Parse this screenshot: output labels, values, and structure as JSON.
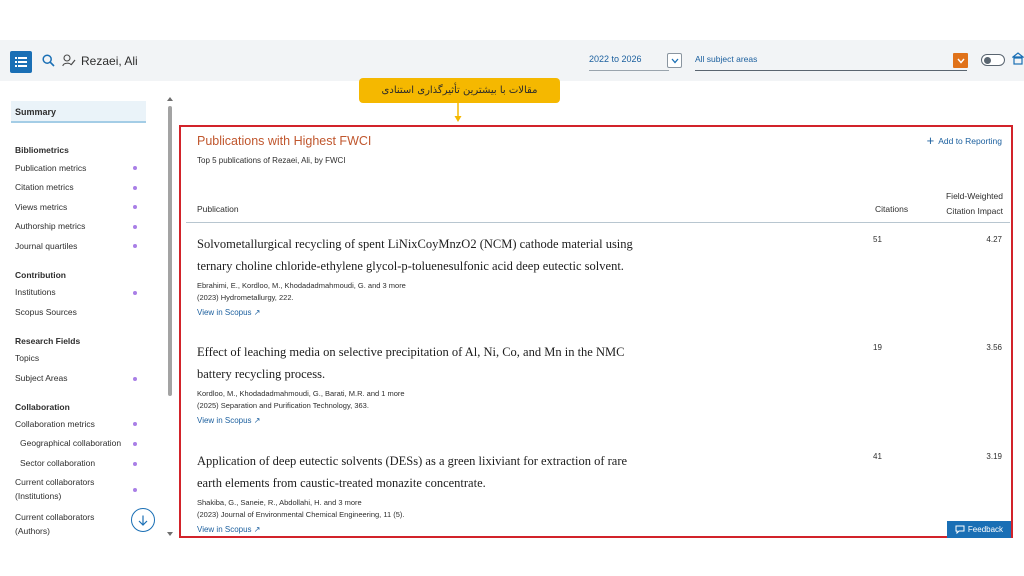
{
  "header": {
    "user_name": "Rezaei, Ali",
    "date_range": "2022 to 2026",
    "subject_area": "All subject areas"
  },
  "sidebar": {
    "summary": "Summary",
    "sections": [
      {
        "title": "Bibliometrics",
        "items": [
          "Publication metrics",
          "Citation metrics",
          "Views metrics",
          "Authorship metrics",
          "Journal quartiles"
        ]
      },
      {
        "title": "Contribution",
        "items": [
          "Institutions",
          "Scopus Sources"
        ]
      },
      {
        "title": "Research Fields",
        "items": [
          "Topics",
          "Subject Areas"
        ]
      },
      {
        "title": "Collaboration",
        "items": [
          "Collaboration metrics",
          "Geographical collaboration",
          "Sector collaboration",
          "Current collaborators (Institutions)",
          "Current collaborators (Authors)"
        ]
      }
    ]
  },
  "callout": {
    "text": "مقالات با بیشترین تأثیرگذاری استنادی",
    "color": "#f5b800"
  },
  "panel": {
    "title": "Publications with Highest FWCI",
    "subtitle": "Top 5 publications of Rezaei, Ali, by FWCI",
    "add_to_reporting": "Add to Reporting",
    "col_publication": "Publication",
    "col_citations": "Citations",
    "col_fwci_line1": "Field-Weighted",
    "col_fwci_line2": "Citation Impact",
    "highlight_color": "#d2232a",
    "rows": [
      {
        "title_line1": "Solvometallurgical recycling of spent LiNixCoyMnzO2 (NCM) cathode material using",
        "title_line2": "ternary choline chloride-ethylene glycol-p-toluenesulfonic acid deep eutectic solvent.",
        "authors": "Ebrahimi, E., Kordloo, M., Khodadadmahmoudi, G. and 3 more",
        "source": "(2023) Hydrometallurgy, 222.",
        "link": "View in Scopus",
        "citations": "51",
        "fwci": "4.27"
      },
      {
        "title_line1": "Effect of leaching media on selective precipitation of Al, Ni, Co, and Mn in the NMC",
        "title_line2": "battery recycling process.",
        "authors": "Kordloo, M., Khodadadmahmoudi, G., Barati, M.R. and 1 more",
        "source": "(2025) Separation and Purification Technology, 363.",
        "link": "View in Scopus",
        "citations": "19",
        "fwci": "3.56"
      },
      {
        "title_line1": "Application of deep eutectic solvents (DESs) as a green lixiviant for extraction of rare",
        "title_line2": "earth elements from caustic-treated monazite concentrate.",
        "authors": "Shakiba, G., Saneie, R., Abdollahi, H. and 3 more",
        "source": "(2023) Journal of Environmental Chemical Engineering, 11 (5).",
        "link": "View in Scopus",
        "citations": "41",
        "fwci": "3.19"
      }
    ]
  },
  "feedback": "Feedback",
  "colors": {
    "brand_blue": "#1a6fb5",
    "title_orange": "#c0572e",
    "dropdown_orange": "#e0721a",
    "dot_purple": "#a97fe6"
  }
}
